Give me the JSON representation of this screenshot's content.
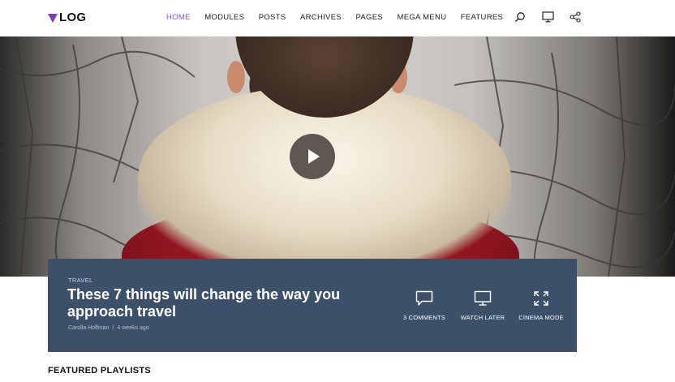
{
  "brand": {
    "logo_text": "LOG",
    "accent": "#8a4fc9"
  },
  "nav": {
    "items": [
      {
        "label": "HOME",
        "active": true
      },
      {
        "label": "MODULES",
        "active": false
      },
      {
        "label": "POSTS",
        "active": false
      },
      {
        "label": "ARCHIVES",
        "active": false
      },
      {
        "label": "PAGES",
        "active": false
      },
      {
        "label": "MEGA MENU",
        "active": false
      },
      {
        "label": "FEATURES",
        "active": false
      }
    ]
  },
  "header_icons": [
    "search-icon",
    "monitor-icon",
    "share-icon"
  ],
  "hero": {
    "play_icon": "play-icon"
  },
  "post": {
    "category": "TRAVEL",
    "title": "These 7 things will change the way you approach travel",
    "author": "Carolla Hoffman",
    "separator": "/",
    "date": "4 weeks ago",
    "panel_color": "#3d5069"
  },
  "actions": [
    {
      "icon": "comment-icon",
      "label": "3 COMMENTS"
    },
    {
      "icon": "monitor-icon",
      "label": "WATCH LATER"
    },
    {
      "icon": "expand-icon",
      "label": "CINEMA MODE"
    }
  ],
  "featured": {
    "heading": "FEATURED PLAYLISTS"
  }
}
